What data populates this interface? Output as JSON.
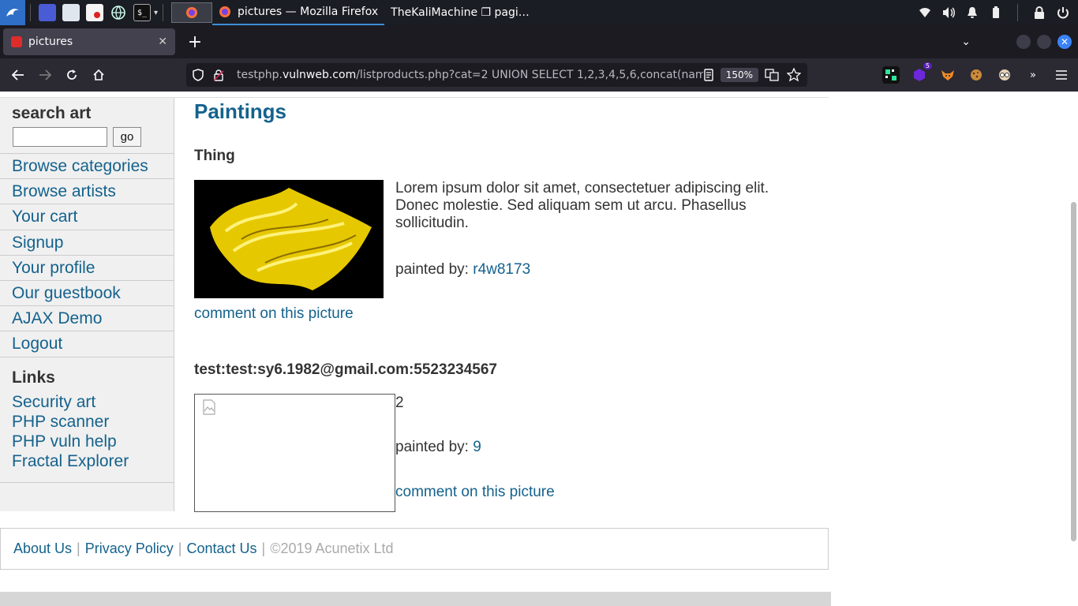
{
  "taskbar": {
    "windows": [
      {
        "label": "pictures — Mozilla Firefox",
        "icon": "firefox-icon"
      },
      {
        "label": "TheKaliMachine ❐ pagi…",
        "icon": "terminal-icon"
      }
    ]
  },
  "tabs": [
    {
      "title": "pictures",
      "icon": "favicon"
    }
  ],
  "toolbar": {
    "url_prefix": "testphp.",
    "url_host": "vulnweb.com",
    "url_path": "/listproducts.php?cat=2 UNION SELECT 1,2,3,4,5,6,concat(nam",
    "zoom": "150%",
    "extension_badge": "5"
  },
  "sidebar": {
    "search_title": "search art",
    "search_value": "",
    "go_label": "go",
    "nav": [
      "Browse categories",
      "Browse artists",
      "Your cart",
      "Signup",
      "Your profile",
      "Our guestbook",
      "AJAX Demo",
      "Logout"
    ],
    "links_title": "Links",
    "links": [
      "Security art",
      "PHP scanner",
      "PHP vuln help",
      "Fractal Explorer"
    ]
  },
  "main": {
    "heading": "Paintings",
    "items": [
      {
        "title": "Thing",
        "description": "Lorem ipsum dolor sit amet, consectetuer adipiscing elit. Donec molestie. Sed aliquam sem ut arcu. Phasellus sollicitudin.",
        "painted_by_label": "painted by:",
        "artist": "r4w8173",
        "comment_link": "comment on this picture"
      },
      {
        "title": "test:test:sy6.1982@gmail.com:5523234567",
        "description": "2",
        "painted_by_label": "painted by:",
        "artist": "9",
        "comment_link": "comment on this picture"
      }
    ]
  },
  "footer": {
    "links": [
      "About Us",
      "Privacy Policy",
      "Contact Us"
    ],
    "separator": "|",
    "copyright": "©2019 Acunetix Ltd"
  },
  "colors": {
    "link": "#14628d",
    "text": "#333333",
    "sidebar_bg": "#f0f0f0",
    "taskbar_bg": "#1b1d24",
    "browser_chrome": "#2b2a33"
  }
}
